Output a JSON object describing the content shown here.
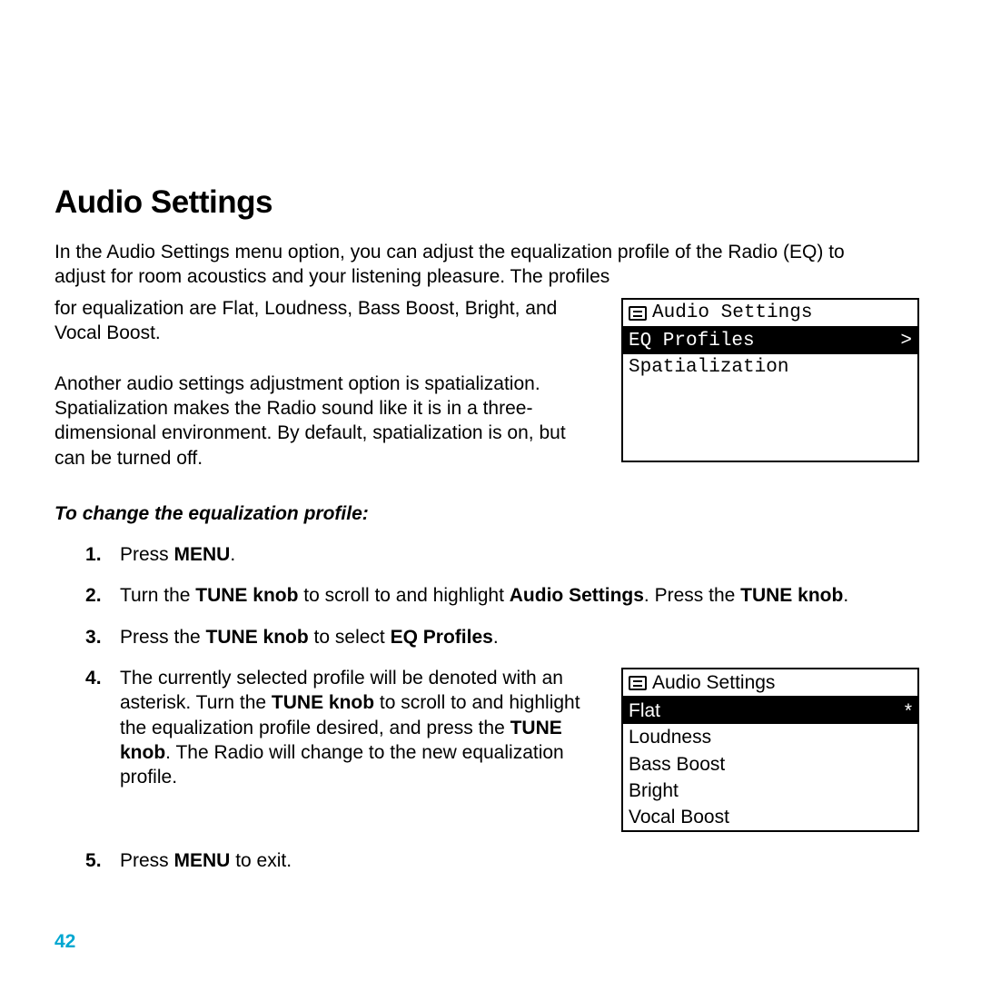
{
  "title": "Audio Settings",
  "intro_full": "In the Audio Settings menu option, you can adjust the equalization profile of the Radio (EQ) to adjust for room acoustics and your listening pleasure. The profiles for equalization are Flat, Loudness, Bass Boost, Bright, and Vocal Boost.",
  "intro_split_left": "for equalization are Flat, Loudness, Bass Boost, Bright, and Vocal Boost.",
  "intro_lead": "In the Audio Settings menu option, you can adjust the equalization profile of the Radio (EQ) to adjust for room acoustics and your listening pleasure. The profiles",
  "para2": "Another audio settings adjustment option is spatialization. Spatialization makes the Radio sound like it is in a three-dimensional environment. By default, spatialization is on, but can be turned off.",
  "screen1": {
    "title": "Audio Settings",
    "rows": [
      {
        "label": "EQ Profiles",
        "mark": ">",
        "selected": true
      },
      {
        "label": "Spatialization",
        "mark": "",
        "selected": false
      }
    ]
  },
  "instr_head": "To change the equalization profile:",
  "steps": {
    "s1_a": "Press ",
    "s1_b": "MENU",
    "s1_c": ".",
    "s2_a": "Turn the ",
    "s2_b": "TUNE knob",
    "s2_c": " to scroll to and highlight ",
    "s2_d": "Audio Settings",
    "s2_e": ". Press the ",
    "s2_f": "TUNE knob",
    "s2_g": ".",
    "s3_a": "Press the ",
    "s3_b": "TUNE knob",
    "s3_c": " to select ",
    "s3_d": "EQ Profiles",
    "s3_e": ".",
    "s4_a": "The currently selected profile will be denoted with an asterisk. Turn the ",
    "s4_b": "TUNE knob",
    "s4_c": " to scroll to and highlight the equalization profile desired, and press the ",
    "s4_d": "TUNE knob",
    "s4_e": ". The Radio will change to the new equalization profile.",
    "s5_a": "Press ",
    "s5_b": "MENU",
    "s5_c": " to exit."
  },
  "screen2": {
    "title": "Audio Settings",
    "rows": [
      {
        "label": "Flat",
        "mark": "*",
        "selected": true
      },
      {
        "label": "Loudness",
        "mark": "",
        "selected": false
      },
      {
        "label": "Bass Boost",
        "mark": "",
        "selected": false
      },
      {
        "label": "Bright",
        "mark": "",
        "selected": false
      },
      {
        "label": "Vocal Boost",
        "mark": "",
        "selected": false
      }
    ]
  },
  "page_number": "42"
}
